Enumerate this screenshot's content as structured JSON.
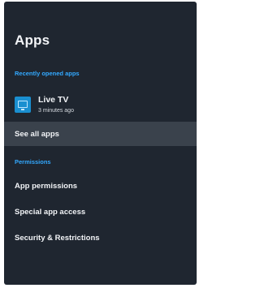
{
  "screen": {
    "title": "Apps"
  },
  "recent": {
    "header": "Recently opened apps",
    "apps": [
      {
        "name": "Live TV",
        "subtitle": "3 minutes ago",
        "icon": "tv-icon"
      }
    ]
  },
  "see_all": {
    "label": "See all apps"
  },
  "permissions": {
    "header": "Permissions",
    "items": [
      {
        "label": "App permissions"
      },
      {
        "label": "Special app access"
      },
      {
        "label": "Security & Restrictions"
      }
    ]
  },
  "colors": {
    "background": "#1f2630",
    "accent": "#33a9ff",
    "selected": "#3a424c"
  }
}
